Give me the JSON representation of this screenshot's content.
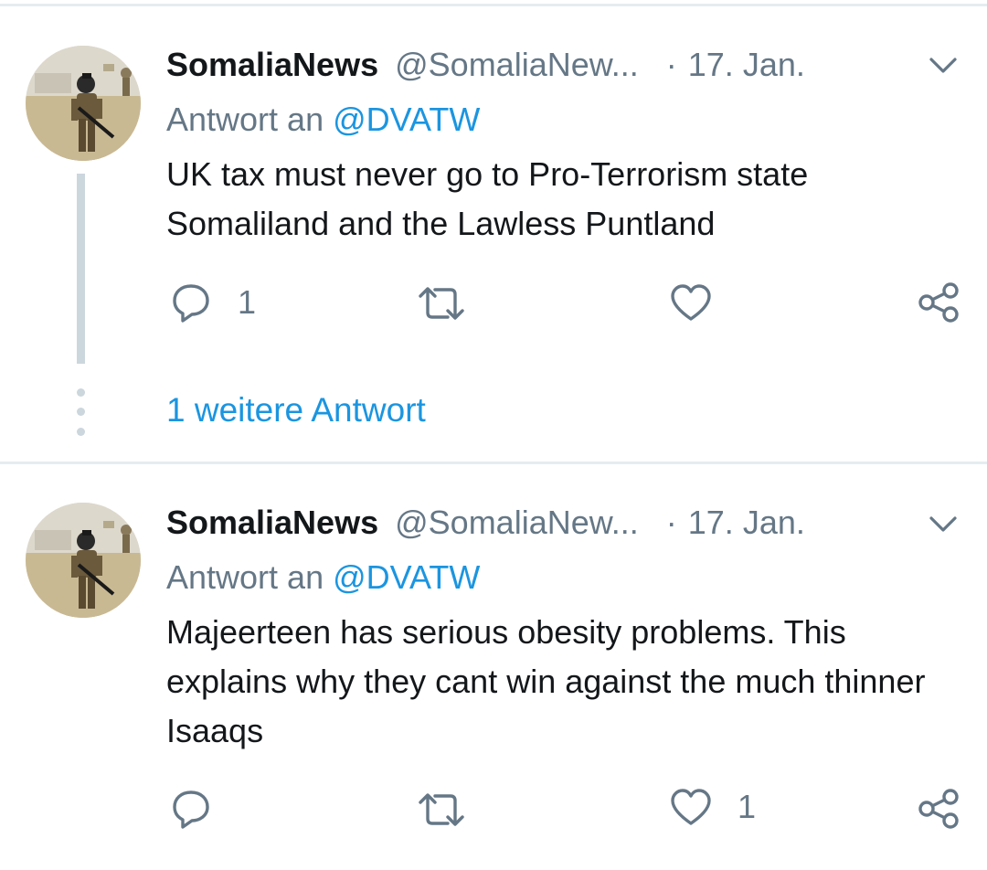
{
  "colors": {
    "accent": "#1b95e0",
    "secondary_text": "#657786",
    "primary_text": "#14171a",
    "divider": "#e6ecf0",
    "thread_line": "#ccd6dd"
  },
  "tweets": [
    {
      "display_name": "SomaliaNews",
      "handle": "@SomaliaNew...",
      "separator": "·",
      "date": "17. Jan.",
      "reply_prefix": "Antwort an",
      "reply_to": "@DVATW",
      "text": "UK tax must never go to Pro-Terrorism state Somaliland and the Lawless Puntland",
      "reply_count": "1",
      "retweet_count": "",
      "like_count": ""
    },
    {
      "display_name": "SomaliaNews",
      "handle": "@SomaliaNew...",
      "separator": "·",
      "date": "17. Jan.",
      "reply_prefix": "Antwort an",
      "reply_to": "@DVATW",
      "text": "Majeerteen has serious obesity problems. This explains why they cant win against the much thinner Isaaqs",
      "reply_count": "",
      "retweet_count": "",
      "like_count": "1"
    }
  ],
  "thread": {
    "more_replies_label": "1 weitere Antwort"
  },
  "icons": [
    "reply-icon",
    "retweet-icon",
    "like-icon",
    "share-icon",
    "chevron-down-icon"
  ]
}
